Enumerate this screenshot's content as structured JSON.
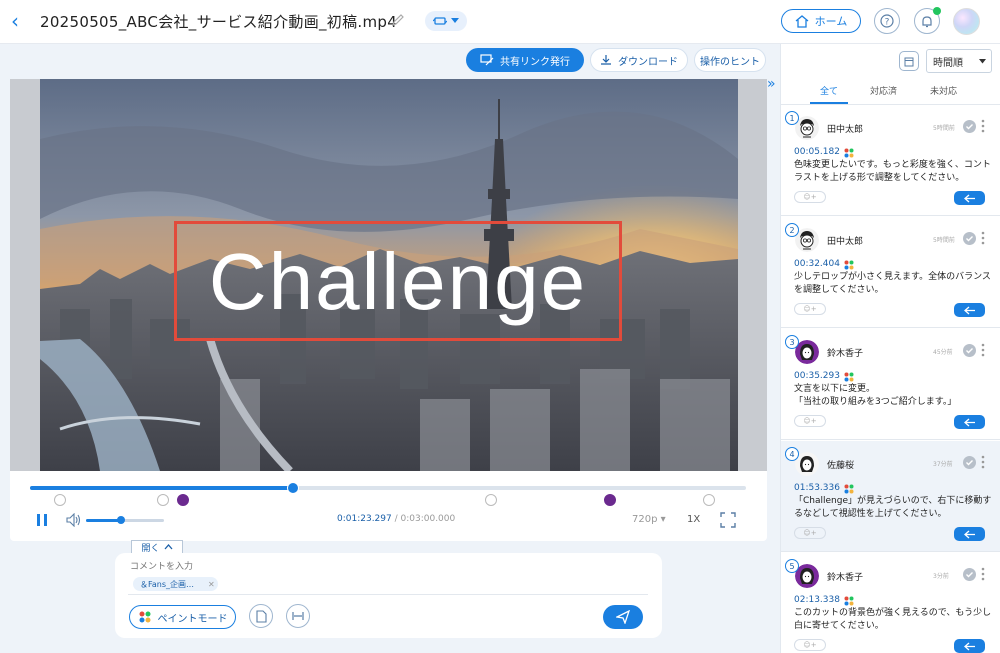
{
  "header": {
    "title": "20250505_ABC会社_サービス紹介動画_初稿.mp4",
    "home_label": "ホーム"
  },
  "toolbar": {
    "share_label": "共有リンク発行",
    "download_label": "ダウンロード",
    "hint_label": "操作のヒント"
  },
  "video": {
    "overlay_text": "Challenge",
    "progress": 0.367
  },
  "player": {
    "current_time": "0:01:23.297",
    "separator": " / ",
    "total_time": "0:03:00.000",
    "quality": "720p ▾",
    "speed": "1X",
    "volume": 0.45
  },
  "composer": {
    "open_label": "開く",
    "placeholder": "コメントを入力",
    "chip_label": "＆Fans_企画…",
    "chip_remove": "✕",
    "paint_mode_label": "ペイントモード"
  },
  "sidebar": {
    "sort_value": "時間順",
    "tabs": [
      "全て",
      "対応済",
      "未対応"
    ],
    "comments": [
      {
        "num": "1",
        "name": "田中太郎",
        "ago": "5時間前",
        "time": "00:05.182",
        "body": "色味変更したいです。もっと彩度を強く、コントラストを上げる形で調整をしてください。",
        "avatar": "man"
      },
      {
        "num": "2",
        "name": "田中太郎",
        "ago": "5時間前",
        "time": "00:32.404",
        "body": "少しテロップが小さく見えます。全体のバランスを調整してください。",
        "avatar": "man"
      },
      {
        "num": "3",
        "name": "鈴木香子",
        "ago": "45分前",
        "time": "00:35.293",
        "body": "文言を以下に変更。\n「当社の取り組みを3つご紹介します。」",
        "avatar": "woman-purple"
      },
      {
        "num": "4",
        "name": "佐藤桜",
        "ago": "37分前",
        "time": "01:53.336",
        "body": "「Challenge」が見えづらいので、右下に移動するなどして視認性を上げてください。",
        "avatar": "woman-white"
      },
      {
        "num": "5",
        "name": "鈴木香子",
        "ago": "3分前",
        "time": "02:13.338",
        "body": "このカットの背景色が強く見えるので、もう少し白に寄せてください。",
        "avatar": "woman-purple"
      }
    ],
    "react_label": "☺+"
  },
  "colors": {
    "accent": "#1a7fe0",
    "highlight_box": "#e24b3b",
    "online": "#22c55e",
    "marker_dark": "#6b2a8f"
  },
  "icons": [
    "back-icon",
    "pencil-icon",
    "home-icon",
    "help-icon",
    "bell-icon",
    "share-icon",
    "download-icon",
    "pause-icon",
    "volume-icon",
    "fullscreen-icon",
    "paint-icon",
    "attach-icon",
    "width-icon",
    "send-icon",
    "calendar-icon",
    "check-icon",
    "more-icon",
    "reply-icon"
  ]
}
